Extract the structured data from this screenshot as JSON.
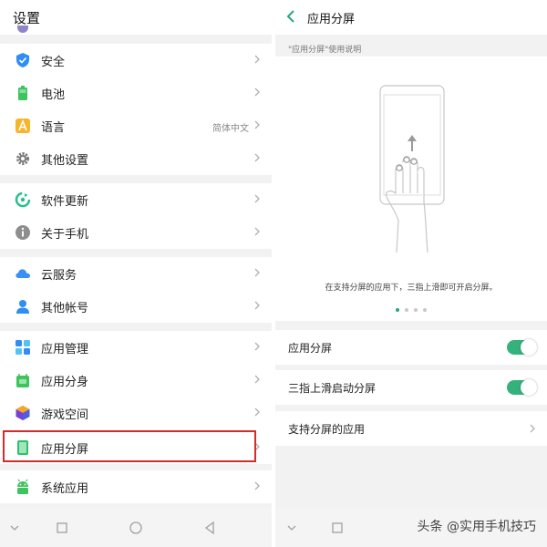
{
  "left": {
    "title": "设置",
    "groups": [
      {
        "items": [
          {
            "label": "安全",
            "icon": "shield-icon",
            "color": "#2f8df5"
          },
          {
            "label": "电池",
            "icon": "battery-icon",
            "color": "#3ec45e"
          },
          {
            "label": "语言",
            "value": "简体中文",
            "icon": "language-icon",
            "color": "#f7b52c"
          },
          {
            "label": "其他设置",
            "icon": "gear-icon",
            "color": "#7b7b7b"
          }
        ]
      },
      {
        "items": [
          {
            "label": "软件更新",
            "icon": "update-icon",
            "color": "#27c08b"
          },
          {
            "label": "关于手机",
            "icon": "info-icon",
            "color": "#8e8e8e"
          }
        ]
      },
      {
        "items": [
          {
            "label": "云服务",
            "icon": "cloud-icon",
            "color": "#3a8ef6"
          },
          {
            "label": "其他帐号",
            "icon": "person-icon",
            "color": "#2f8df5"
          }
        ]
      },
      {
        "items": [
          {
            "label": "应用管理",
            "icon": "app-grid-icon",
            "color": "#2f8df5"
          },
          {
            "label": "应用分身",
            "icon": "clone-app-icon",
            "color": "#3ec45e"
          },
          {
            "label": "游戏空间",
            "icon": "game-space-icon",
            "color": "#7a3fd6"
          },
          {
            "label": "应用分屏",
            "icon": "split-screen-icon",
            "color": "#2fbf6b"
          }
        ]
      },
      {
        "items": [
          {
            "label": "系统应用",
            "icon": "android-icon",
            "color": "#3ec45e"
          }
        ]
      }
    ]
  },
  "right": {
    "title": "应用分屏",
    "caption": "\"应用分屏\"使用说明",
    "illustration_text": "在支持分屏的应用下，三指上滑即可开启分屏。",
    "page_count": 4,
    "active_page": 1,
    "settings": [
      {
        "label": "应用分屏",
        "type": "toggle",
        "on": true
      },
      {
        "label": "三指上滑启动分屏",
        "type": "toggle",
        "on": true
      },
      {
        "label": "支持分屏的应用",
        "type": "link"
      }
    ],
    "watermark": "头条 @实用手机技巧"
  },
  "colors": {
    "accent": "#34b27c",
    "highlight": "#d42b2b"
  }
}
